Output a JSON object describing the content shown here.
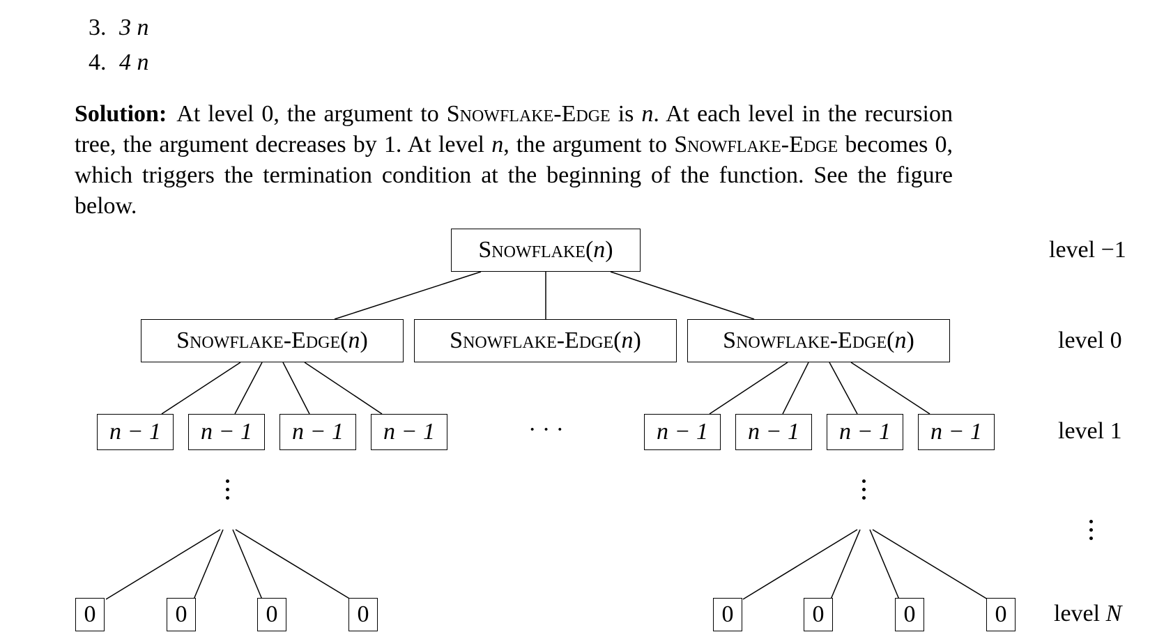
{
  "list_items": [
    {
      "number": "3.",
      "expr": "3 n"
    },
    {
      "number": "4.",
      "expr": "4 n"
    }
  ],
  "solution": {
    "heading": "Solution:",
    "text_1": "At level 0, the argument to ",
    "sc_1": "Snowflake-Edge",
    "text_2": " is ",
    "math_1": "n",
    "text_3": ". At each level in the recursion tree, the argument decreases by 1. At level ",
    "math_2": "n",
    "text_4": ", the argument to ",
    "sc_2": "Snowflake-Edge",
    "text_5": " becomes 0, which triggers the termination condition at the beginning of the function. See the figure below."
  },
  "tree": {
    "root": {
      "name": "Snowflake",
      "arg": "n"
    },
    "edge_nodes": [
      {
        "name": "Snowflake-Edge",
        "arg": "n"
      },
      {
        "name": "Snowflake-Edge",
        "arg": "n"
      },
      {
        "name": "Snowflake-Edge",
        "arg": "n"
      }
    ],
    "level1_label": "n − 1",
    "leaf_label": "0",
    "hdots": "· · ·"
  },
  "levels": {
    "minus1": "level −1",
    "zero": "level 0",
    "one": "level 1",
    "n_prefix": "level ",
    "n_var": "N"
  }
}
